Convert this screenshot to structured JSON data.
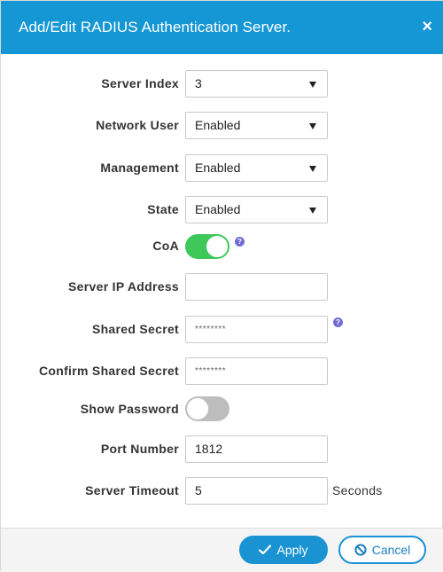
{
  "dialog": {
    "title": "Add/Edit RADIUS Authentication Server.",
    "close_label": "×"
  },
  "form": {
    "server_index": {
      "label": "Server Index",
      "value": "3"
    },
    "network_user": {
      "label": "Network User",
      "value": "Enabled"
    },
    "management": {
      "label": "Management",
      "value": "Enabled"
    },
    "state": {
      "label": "State",
      "value": "Enabled"
    },
    "coa": {
      "label": "CoA",
      "enabled": true,
      "help": "?"
    },
    "server_ip": {
      "label": "Server IP Address",
      "value": ""
    },
    "shared_secret": {
      "label": "Shared Secret",
      "value": "********",
      "help": "?"
    },
    "confirm_secret": {
      "label": "Confirm Shared Secret",
      "value": "********"
    },
    "show_password": {
      "label": "Show Password",
      "enabled": false
    },
    "port_number": {
      "label": "Port Number",
      "value": "1812"
    },
    "server_timeout": {
      "label": "Server Timeout",
      "value": "5",
      "unit": "Seconds"
    }
  },
  "footer": {
    "apply_label": "Apply",
    "cancel_label": "Cancel"
  },
  "colors": {
    "header": "#1697d5",
    "toggle_on": "#3ec85a",
    "toggle_off": "#bdbdbd",
    "help": "#6f6cd6"
  }
}
